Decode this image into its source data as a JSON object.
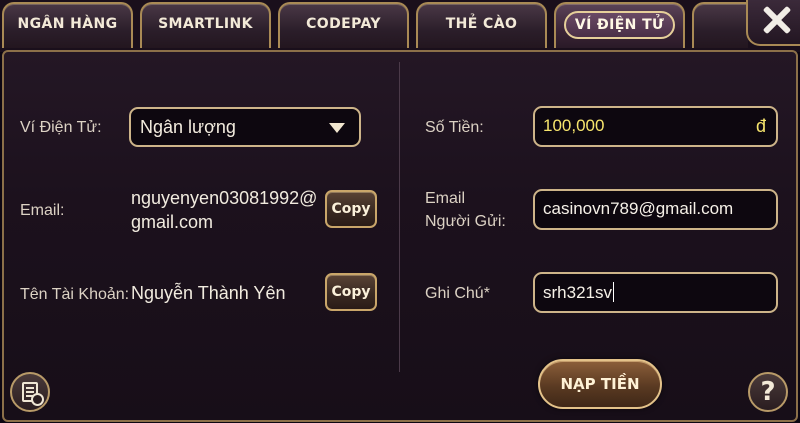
{
  "tabs": [
    {
      "label": "NGÂN HÀNG",
      "active": false
    },
    {
      "label": "SMARTLINK",
      "active": false
    },
    {
      "label": "CODEPAY",
      "active": false
    },
    {
      "label": "THẺ CÀO",
      "active": false
    },
    {
      "label": "VÍ ĐIỆN TỬ",
      "active": true
    }
  ],
  "left": {
    "wallet_label": "Ví Điện Tử:",
    "wallet_selected": "Ngân lượng",
    "email_label": "Email:",
    "email_line1": "nguyenyen03081992@",
    "email_line2": "gmail.com",
    "copy_label": "Copy",
    "account_name_label": "Tên Tài Khoản:",
    "account_name_value": "Nguyễn Thành Yên"
  },
  "right": {
    "amount_label": "Số Tiền:",
    "amount_value": "100,000",
    "currency_symbol": "đ",
    "sender_email_label_line1": "Email",
    "sender_email_label_line2": "Người Gửi:",
    "sender_email_value": "casinovn789@gmail.com",
    "note_label": "Ghi Chú*",
    "note_value": "srh321sv"
  },
  "actions": {
    "submit_label": "NẠP TIỀN",
    "help_label": "?"
  },
  "icons": {
    "close": "close-icon",
    "history": "history-icon",
    "dropdown": "chevron-down-icon"
  },
  "colors": {
    "accent_gold": "#cdb489",
    "amount_text": "#f7e56d",
    "panel_bg": "#1c111d"
  }
}
